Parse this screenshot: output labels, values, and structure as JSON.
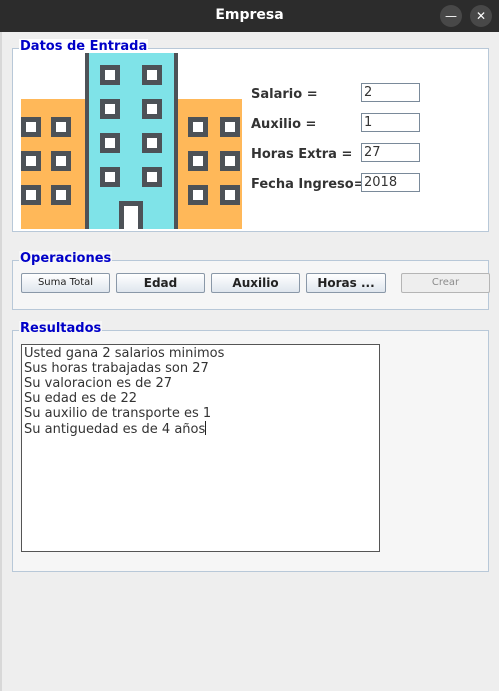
{
  "window": {
    "title": "Empresa",
    "minimize_icon": "minimize-icon",
    "close_icon": "close-icon"
  },
  "entrada": {
    "legend": "Datos de Entrada",
    "image": "building-icon",
    "fields": [
      {
        "label": "Salario =",
        "value": "2"
      },
      {
        "label": "Auxilio =",
        "value": "1"
      },
      {
        "label": "Horas Extra =",
        "value": "27"
      },
      {
        "label": "Fecha Ingreso=",
        "value": "2018"
      }
    ]
  },
  "operaciones": {
    "legend": "Operaciones",
    "buttons": [
      {
        "label": "Suma Total",
        "enabled": true
      },
      {
        "label": "Edad",
        "enabled": true
      },
      {
        "label": "Auxilio",
        "enabled": true
      },
      {
        "label": "Horas ...",
        "enabled": true
      },
      {
        "label": "Crear",
        "enabled": false
      }
    ]
  },
  "resultados": {
    "legend": "Resultados",
    "lines": [
      "Usted gana 2 salarios minimos",
      "Sus horas trabajadas son 27",
      "Su valoracion es de 27",
      "Su edad es de 22",
      "Su auxilio de transporte es 1",
      "Su antiguedad es de 4 años"
    ]
  },
  "colors": {
    "legend": "#0000c8",
    "building_center": "#7fe3e8",
    "building_sides": "#ffb859",
    "window_frame": "#4d5257"
  }
}
